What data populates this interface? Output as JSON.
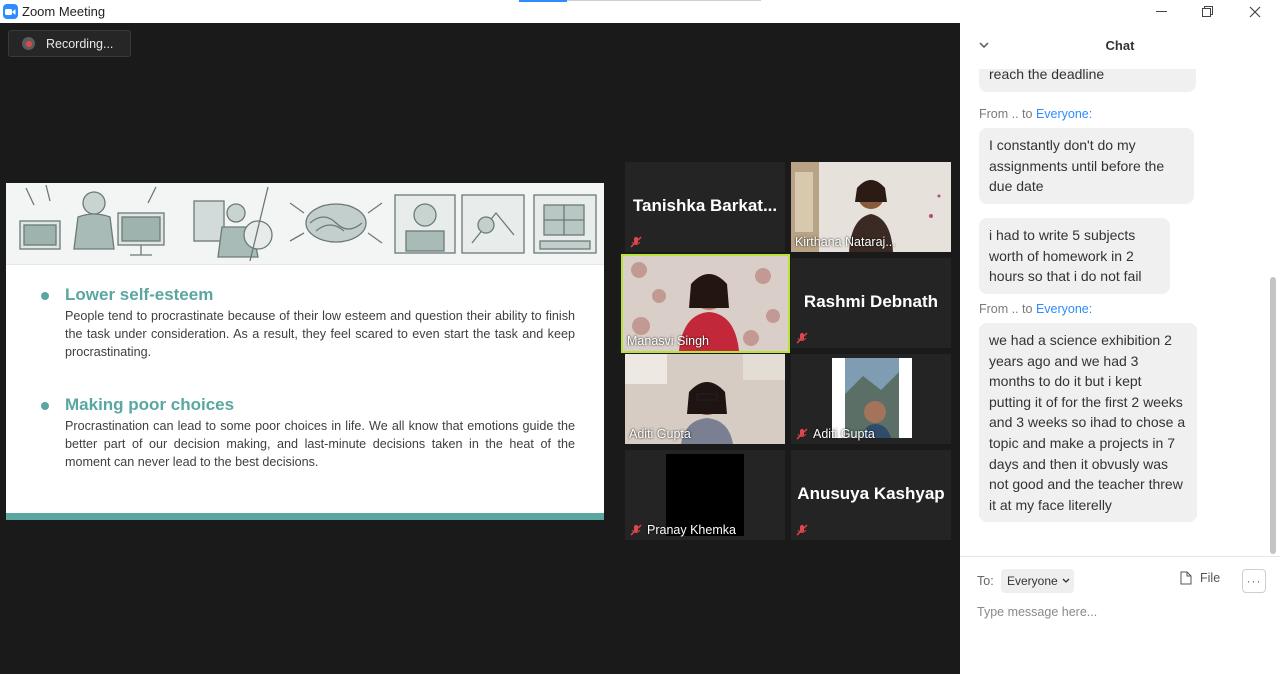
{
  "window": {
    "title": "Zoom Meeting"
  },
  "recording": {
    "label": "Recording..."
  },
  "slide": {
    "points": [
      {
        "heading": "Lower self-esteem",
        "body": "People tend to procrastinate because of their low esteem and question their ability to finish the task under consideration. As a result, they feel scared to even start the task and keep procrastinating."
      },
      {
        "heading": "Making poor choices",
        "body": "Procrastination can lead to some poor choices in life. We all know that emotions guide the better part of our decision making, and last-minute decisions taken in the heat of the moment can never lead to the best decisions."
      }
    ],
    "accent_color": "#5aa6a0"
  },
  "gallery": {
    "tiles": [
      {
        "display_name": "Tanishka  Barkat...",
        "muted": true,
        "video": false
      },
      {
        "label": "Kirthana Nataraj...",
        "muted": false,
        "video": true
      },
      {
        "label": "Manasvi Singh",
        "muted": false,
        "video": true,
        "active_speaker": true
      },
      {
        "display_name": "Rashmi Debnath",
        "muted": true,
        "video": false
      },
      {
        "label": "Aditi Gupta",
        "muted": false,
        "video": true
      },
      {
        "label": "Aditi Gupta",
        "muted": true,
        "video": true
      },
      {
        "label": "Pranay Khemka",
        "muted": true,
        "video": true
      },
      {
        "display_name": "Anusuya Kashyap",
        "muted": true,
        "video": false
      }
    ],
    "active_speaker_color": "#b9e23b"
  },
  "chat": {
    "title": "Chat",
    "messages": [
      {
        "text": "reach the deadline"
      },
      {
        "from": "From .. to ",
        "to": "Everyone:",
        "text": "I constantly don't do my assignments until before the due date"
      },
      {
        "text": "i had to write 5 subjects worth of homework in 2 hours so that i do not fail"
      },
      {
        "from": "From .. to ",
        "to": "Everyone:",
        "text": "we had a science exhibition 2 years ago and we had 3 months to do it but i kept putting it of for the first 2 weeks and 3 weeks so ihad to chose a topic and make a projects in 7 days and then it obvusly was not good and the teacher threw it at my face literelly"
      }
    ],
    "composer": {
      "to_label": "To:",
      "recipient": "Everyone",
      "file_label": "File",
      "placeholder": "Type message here..."
    },
    "link_color": "#2d8cff"
  }
}
